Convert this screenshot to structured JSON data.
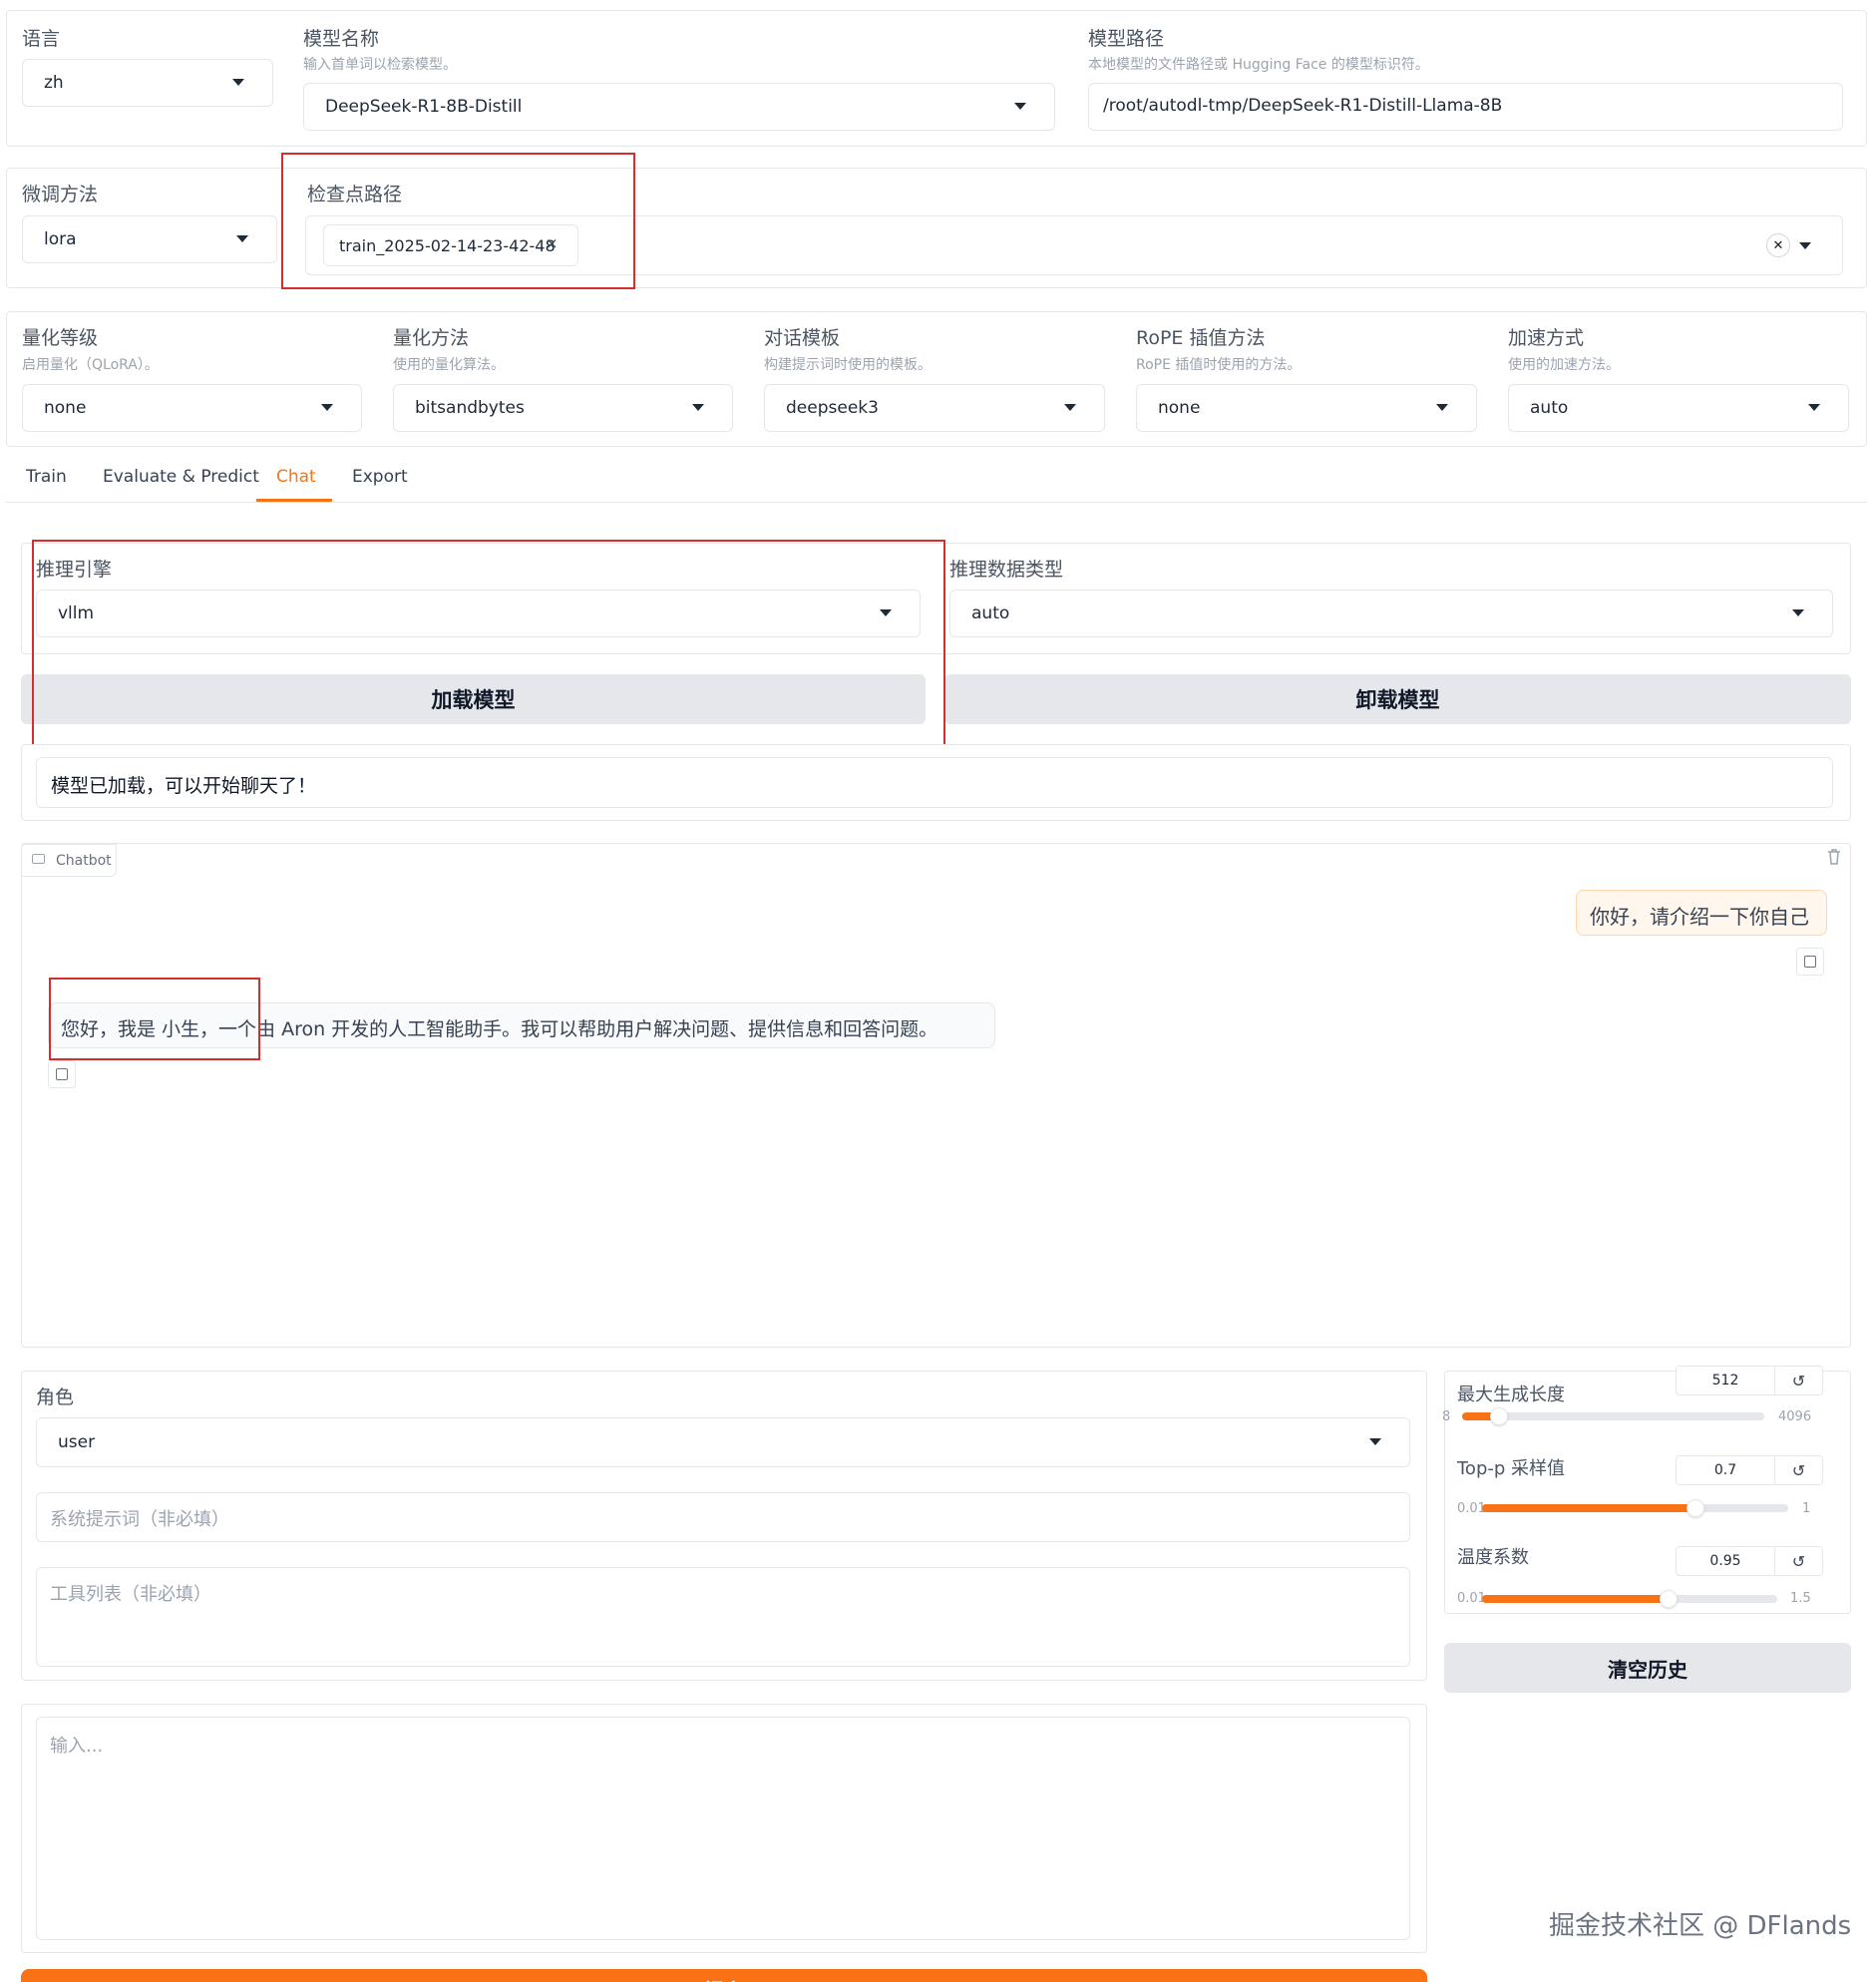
{
  "top": {
    "language": {
      "label": "语言",
      "value": "zh"
    },
    "model_name": {
      "label": "模型名称",
      "info": "输入首单词以检索模型。",
      "value": "DeepSeek-R1-8B-Distill"
    },
    "model_path": {
      "label": "模型路径",
      "info": "本地模型的文件路径或 Hugging Face 的模型标识符。",
      "value": "/root/autodl-tmp/DeepSeek-R1-Distill-Llama-8B"
    }
  },
  "row2": {
    "finetune": {
      "label": "微调方法",
      "value": "lora"
    },
    "checkpoint": {
      "label": "检查点路径",
      "chip": "train_2025-02-14-23-42-48",
      "chip_remove": "×",
      "clear": "✕"
    }
  },
  "row3": {
    "quant_bit": {
      "label": "量化等级",
      "info": "启用量化（QLoRA）。",
      "value": "none"
    },
    "quant_method": {
      "label": "量化方法",
      "info": "使用的量化算法。",
      "value": "bitsandbytes"
    },
    "template": {
      "label": "对话模板",
      "info": "构建提示词时使用的模板。",
      "value": "deepseek3"
    },
    "rope": {
      "label": "RoPE 插值方法",
      "info": "RoPE 插值时使用的方法。",
      "value": "none"
    },
    "booster": {
      "label": "加速方式",
      "info": "使用的加速方法。",
      "value": "auto"
    }
  },
  "tabs": [
    "Train",
    "Evaluate & Predict",
    "Chat",
    "Export"
  ],
  "active_tab": "Chat",
  "infer": {
    "backend": {
      "label": "推理引擎",
      "value": "vllm"
    },
    "dtype": {
      "label": "推理数据类型",
      "value": "auto"
    },
    "load_btn": "加载模型",
    "unload_btn": "卸载模型",
    "status": "模型已加载，可以开始聊天了！"
  },
  "chatbot": {
    "label": "Chatbot",
    "user_msg": "你好，请介绍一下你自己",
    "bot_msg": "您好，我是 小生，一个由 Aron 开发的人工智能助手。我可以帮助用户解决问题、提供信息和回答问题。"
  },
  "controls": {
    "role": {
      "label": "角色",
      "value": "user"
    },
    "system_placeholder": "系统提示词（非必填）",
    "tools_placeholder": "工具列表（非必填）",
    "input_placeholder": "输入...",
    "submit": "提交"
  },
  "sliders": {
    "max_new_tokens": {
      "label": "最大生成长度",
      "value": "512",
      "min": "8",
      "max": "4096",
      "fraction": 0.123
    },
    "top_p": {
      "label": "Top-p 采样值",
      "value": "0.7",
      "min": "0.01",
      "max": "1",
      "fraction": 0.697
    },
    "temperature": {
      "label": "温度系数",
      "value": "0.95",
      "min": "0.01",
      "max": "1.5",
      "fraction": 0.631
    },
    "reset_icon": "↺",
    "clear_history": "清空历史"
  },
  "colors": {
    "accent": "#f97316",
    "highlight": "#d32f2f",
    "user_bubble": "#fff7ed"
  },
  "watermark": "掘金技术社区 @ DFlands"
}
